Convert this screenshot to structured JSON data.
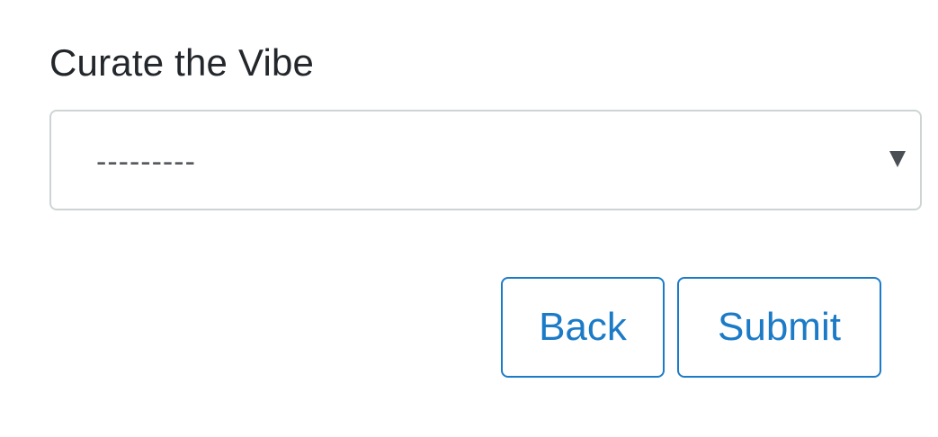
{
  "form": {
    "title": "Curate the Vibe",
    "select": {
      "selected_value": "---------",
      "icon": "chevron-down-icon"
    },
    "buttons": {
      "back_label": "Back",
      "submit_label": "Submit"
    }
  },
  "colors": {
    "title_text": "#23272b",
    "select_border": "#ced4d4",
    "placeholder_text": "#555a5f",
    "button_accent": "#1c7bc7",
    "background": "#ffffff"
  }
}
